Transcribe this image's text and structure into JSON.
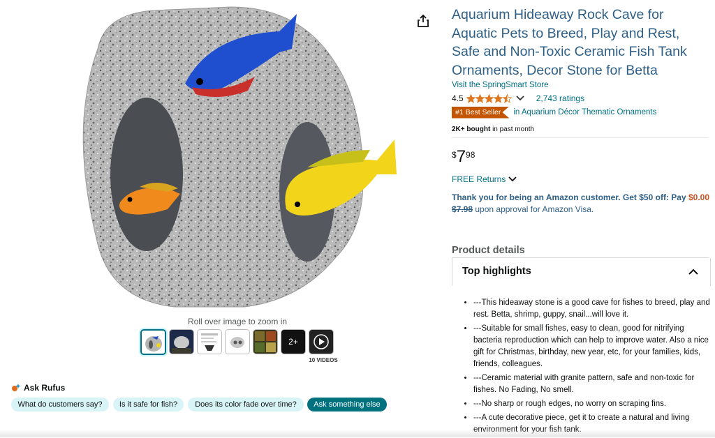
{
  "media": {
    "zoom_hint": "Roll over image to zoom in",
    "thumbnails_overflow": "2+",
    "videos_label": "10 VIDEOS"
  },
  "rufus": {
    "label": "Ask Rufus",
    "chips": [
      "What do customers say?",
      "Is it safe for fish?",
      "Does its color fade over time?",
      "Ask something else"
    ]
  },
  "product": {
    "title": "Aquarium Hideaway Rock Cave for Aquatic Pets to Breed, Play and Rest, Safe and Non-Toxic Ceramic Fish Tank Ornaments, Decor Stone for Betta",
    "store_link": "Visit the SpringSmart Store",
    "rating_value": "4.5",
    "rating": 4.5,
    "ratings_count": "2,743 ratings",
    "best_seller_badge": "#1 Best Seller",
    "best_seller_category": "in Aquarium Décor Thematic Ornaments",
    "bought_bold": "2K+ bought",
    "bought_rest": "in past month",
    "price_symbol": "$",
    "price_whole": "7",
    "price_fraction": "98",
    "returns": "FREE Returns",
    "promo_text": "Thank you for being an Amazon customer. Get $50 off: Pay",
    "promo_pay": "$0.00",
    "promo_strike": "$7.98",
    "promo_rest": "upon approval for Amazon Visa."
  },
  "details": {
    "section_title": "Product details",
    "highlights_title": "Top highlights",
    "highlights": [
      "---This hideaway stone is a good cave for fishes to breed, play and rest. Betta, shrimp, guppy, snail...will love it.",
      "---Suitable for small fishes, easy to clean, good for nitrifying bacteria reproduction which can help to improve water. Also a nice gift for Christmas, birthday, new year, etc, for your families, kids, friends, colleagues.",
      "---Ceramic material with granite pattern, safe and non-toxic for fishes. No Fading, No smell.",
      "---No sharp or rough edges, no worry on scraping fins.",
      "---A cute decorative piece, get it to create a natural and living environment for your fish tank."
    ]
  },
  "colors": {
    "link": "#007185",
    "title": "#2e5f87",
    "badge": "#c45500",
    "star": "#de7921",
    "chip": "#d9f4f7",
    "chip_dark": "#00727f"
  }
}
